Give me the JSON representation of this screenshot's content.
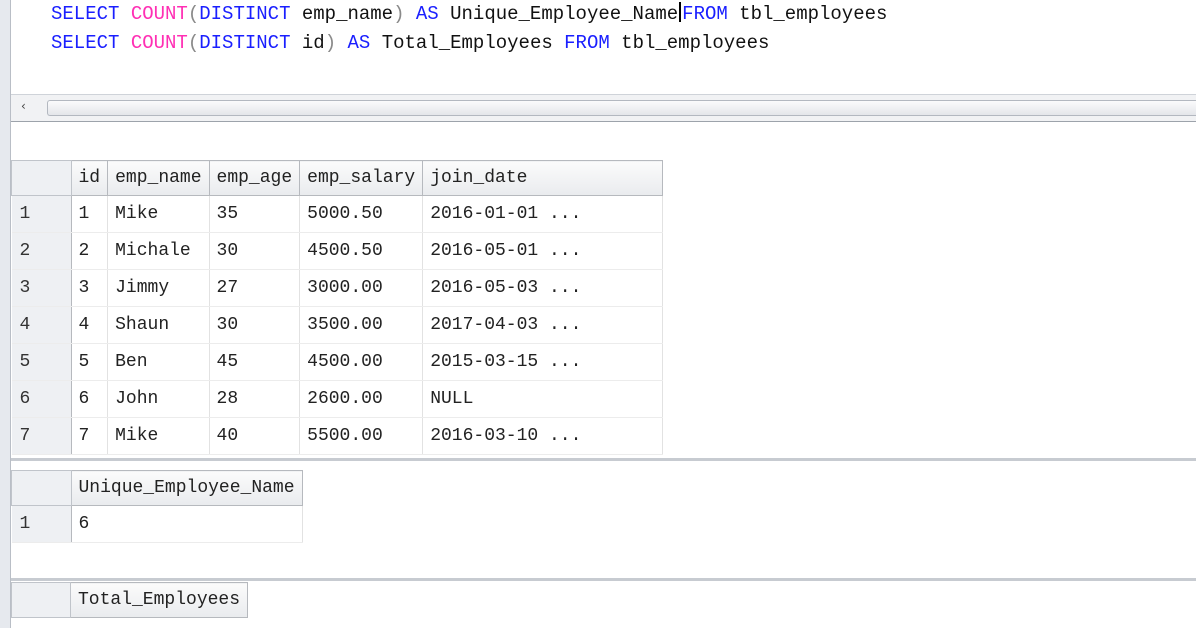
{
  "editor": {
    "line1": {
      "select": "SELECT",
      "count": "COUNT",
      "open_paren": "(",
      "distinct": "DISTINCT",
      "column": " emp_name",
      "close_paren": ")",
      "as": "AS",
      "alias": " Unique_Employee_Name",
      "from": "FROM",
      "table": " tbl_employees"
    },
    "line2": {
      "select": "SELECT",
      "count": "COUNT",
      "open_paren": "(",
      "distinct": "DISTINCT",
      "column": " id",
      "close_paren": ")",
      "as": "AS",
      "alias": " Total_Employees",
      "from": "FROM",
      "table": " tbl_employees"
    }
  },
  "scrollbar": {
    "left_arrow": "‹"
  },
  "result1": {
    "columns": [
      "id",
      "emp_name",
      "emp_age",
      "emp_salary",
      "join_date"
    ],
    "rows": [
      {
        "num": "1",
        "cells": [
          "1",
          "Mike",
          "35",
          "5000.50",
          "2016-01-01 ..."
        ]
      },
      {
        "num": "2",
        "cells": [
          "2",
          "Michale",
          "30",
          "4500.50",
          "2016-05-01 ..."
        ]
      },
      {
        "num": "3",
        "cells": [
          "3",
          "Jimmy",
          "27",
          "3000.00",
          "2016-05-03 ..."
        ]
      },
      {
        "num": "4",
        "cells": [
          "4",
          "Shaun",
          "30",
          "3500.00",
          "2017-04-03 ..."
        ]
      },
      {
        "num": "5",
        "cells": [
          "5",
          "Ben",
          "45",
          "4500.00",
          "2015-03-15 ..."
        ]
      },
      {
        "num": "6",
        "cells": [
          "6",
          "John",
          "28",
          "2600.00",
          "NULL"
        ]
      },
      {
        "num": "7",
        "cells": [
          "7",
          "Mike",
          "40",
          "5500.00",
          "2016-03-10 ..."
        ]
      }
    ]
  },
  "result2": {
    "columns": [
      "Unique_Employee_Name"
    ],
    "rows": [
      {
        "num": "1",
        "cells": [
          "6"
        ]
      }
    ]
  },
  "result3": {
    "columns": [
      "Total_Employees"
    ]
  },
  "colors": {
    "keyword": "#1a1fff",
    "function": "#ff2fb4",
    "paren": "#8a8a8a"
  }
}
